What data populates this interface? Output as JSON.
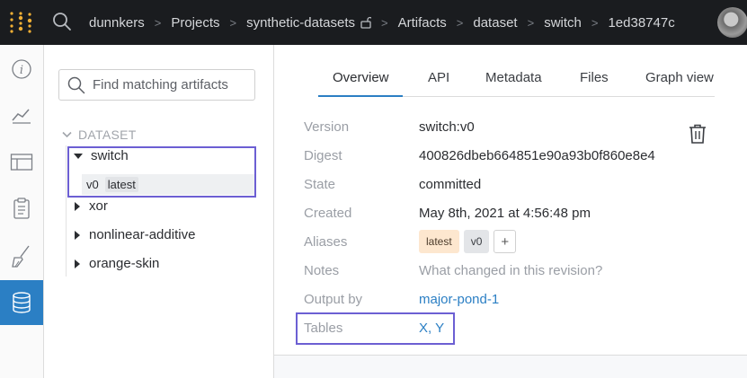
{
  "breadcrumbs": [
    {
      "label": "dunnkers"
    },
    {
      "label": "Projects"
    },
    {
      "label": "synthetic-datasets"
    },
    {
      "label": "Artifacts"
    },
    {
      "label": "dataset"
    },
    {
      "label": "switch"
    },
    {
      "label": "1ed38747c"
    }
  ],
  "separator": ">",
  "sidebar_icons": [
    "info-icon",
    "chart-icon",
    "table-icon",
    "report-icon",
    "sweep-icon",
    "database-icon"
  ],
  "artifacts_panel": {
    "search_placeholder": "Find matching artifacts",
    "group_label": "DATASET",
    "items": [
      {
        "name": "switch",
        "expanded": true,
        "versions": [
          {
            "version": "v0",
            "alias": "latest"
          }
        ]
      },
      {
        "name": "xor",
        "expanded": false
      },
      {
        "name": "nonlinear-additive",
        "expanded": false
      },
      {
        "name": "orange-skin",
        "expanded": false
      }
    ]
  },
  "tabs": [
    {
      "label": "Overview",
      "active": true
    },
    {
      "label": "API",
      "active": false
    },
    {
      "label": "Metadata",
      "active": false
    },
    {
      "label": "Files",
      "active": false
    },
    {
      "label": "Graph view",
      "active": false
    }
  ],
  "overview": {
    "version_label": "Version",
    "version": "switch:v0",
    "digest_label": "Digest",
    "digest": "400826dbeb664851e90a93b0f860e8e4",
    "state_label": "State",
    "state": "committed",
    "created_label": "Created",
    "created": "May 8th, 2021 at 4:56:48 pm",
    "aliases_label": "Aliases",
    "aliases": [
      "latest",
      "v0"
    ],
    "add_alias_label": "+",
    "notes_label": "Notes",
    "notes_placeholder": "What changed in this revision?",
    "output_by_label": "Output by",
    "output_by": "major-pond-1",
    "tables_label": "Tables",
    "tables": "X, Y"
  },
  "colors": {
    "topbar": "#1a1c1f",
    "accent": "#2b7fc4",
    "highlight": "#6c5fd3",
    "logo": "#f2b035"
  }
}
